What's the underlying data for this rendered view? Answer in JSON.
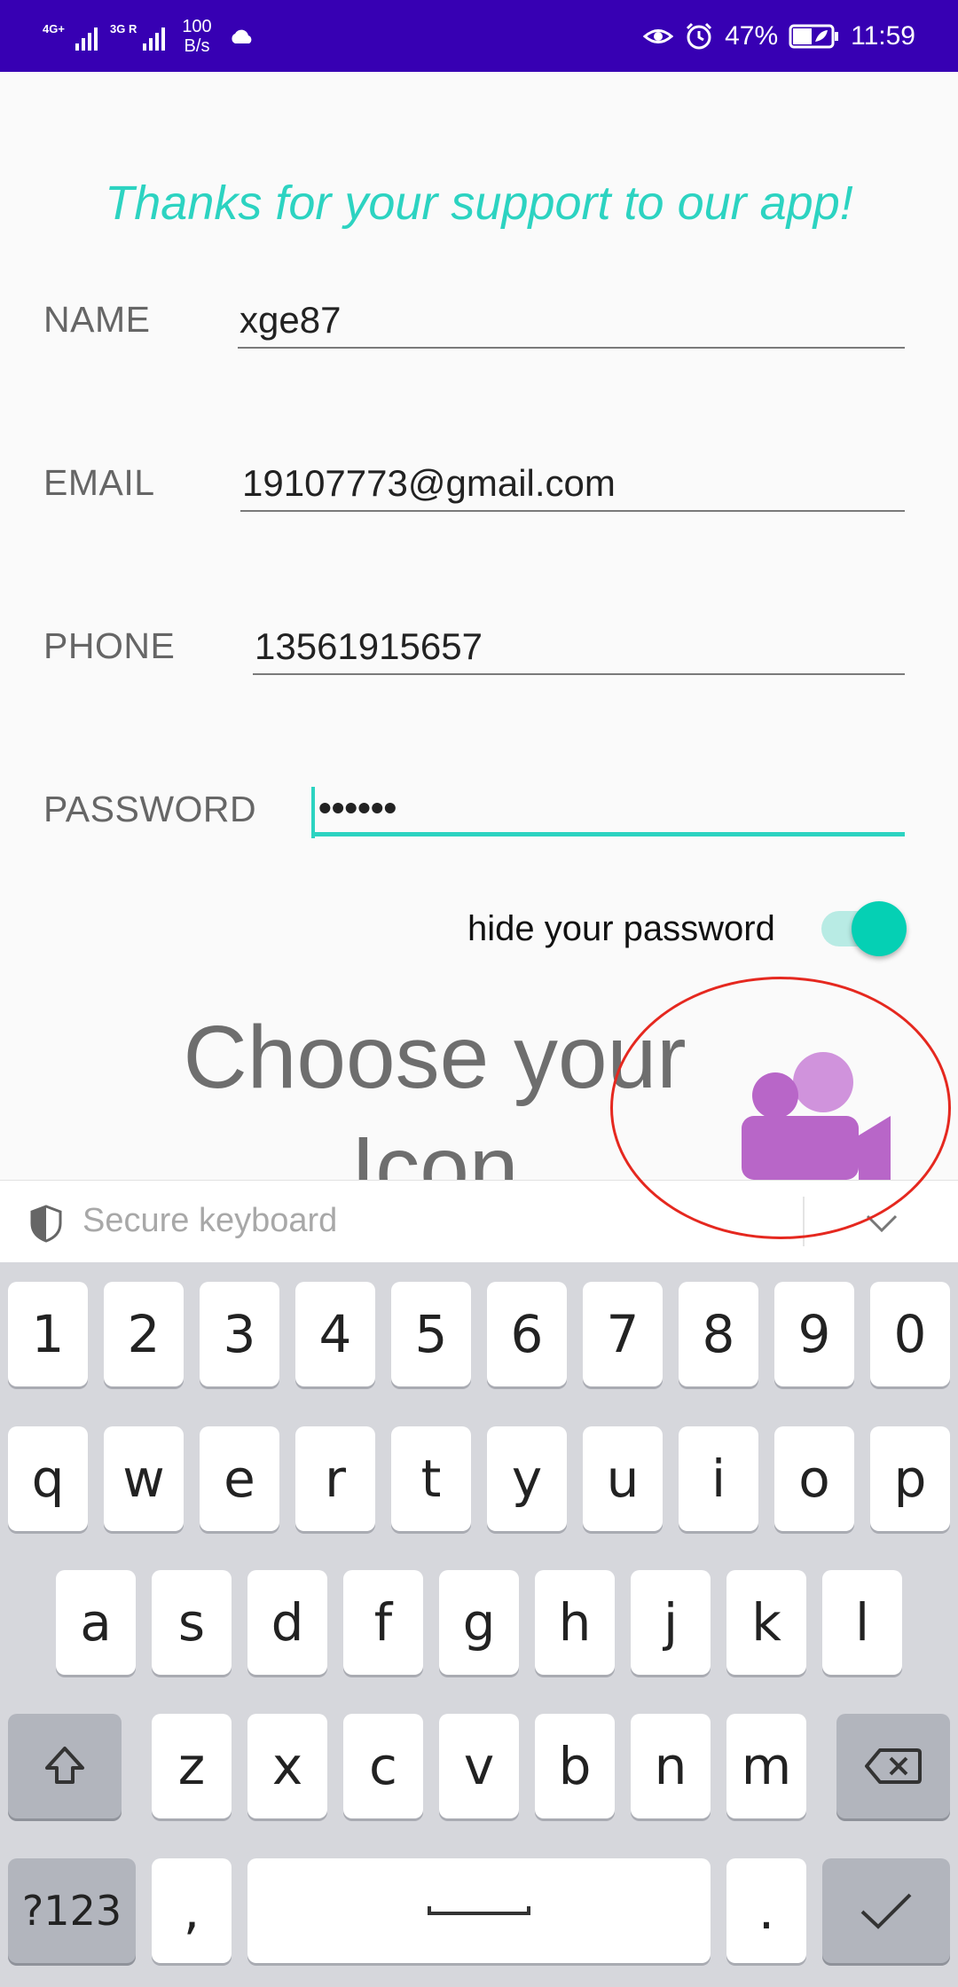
{
  "status_bar": {
    "network1": "4G+",
    "network2": "3G R",
    "speed_value": "100",
    "speed_unit": "B/s",
    "battery": "47%",
    "time": "11:59",
    "icons": [
      "eye-icon",
      "alarm-icon",
      "battery-icon",
      "cloud-icon"
    ]
  },
  "form": {
    "heading": "Thanks for your support to our app!",
    "name_label": "NAME",
    "name_value": "xge87",
    "email_label": "EMAIL",
    "email_value": "19107773@gmail.com",
    "phone_label": "PHONE",
    "phone_value": "13561915657",
    "password_label": "PASSWORD",
    "password_value": "••••••",
    "toggle_label": "hide your password",
    "toggle_on": true,
    "choose_icon": "Choose your Icon"
  },
  "keyboard": {
    "bar_label": "Secure keyboard",
    "row_numbers": [
      "1",
      "2",
      "3",
      "4",
      "5",
      "6",
      "7",
      "8",
      "9",
      "0"
    ],
    "row1": [
      "q",
      "w",
      "e",
      "r",
      "t",
      "y",
      "u",
      "i",
      "o",
      "p"
    ],
    "row2": [
      "a",
      "s",
      "d",
      "f",
      "g",
      "h",
      "j",
      "k",
      "l"
    ],
    "row3": [
      "z",
      "x",
      "c",
      "v",
      "b",
      "n",
      "m"
    ],
    "symbols_key": "?123",
    "comma": ",",
    "period": "."
  },
  "colors": {
    "status_bar": "#3700b3",
    "accent": "#2cd3c1",
    "icon_purple": "#b866c8",
    "annotation": "#e5281f"
  }
}
